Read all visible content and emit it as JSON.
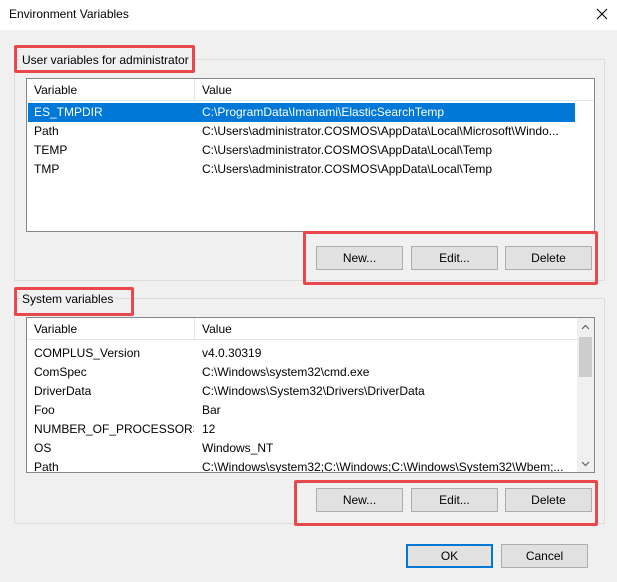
{
  "window": {
    "title": "Environment Variables"
  },
  "user_section": {
    "label": "User variables for administrator",
    "columns": [
      "Variable",
      "Value"
    ],
    "rows": [
      {
        "variable": "ES_TMPDIR",
        "value": "C:\\ProgramData\\Imanami\\ElasticSearchTemp",
        "selected": true
      },
      {
        "variable": "Path",
        "value": "C:\\Users\\administrator.COSMOS\\AppData\\Local\\Microsoft\\Windo..."
      },
      {
        "variable": "TEMP",
        "value": "C:\\Users\\administrator.COSMOS\\AppData\\Local\\Temp"
      },
      {
        "variable": "TMP",
        "value": "C:\\Users\\administrator.COSMOS\\AppData\\Local\\Temp"
      }
    ],
    "buttons": {
      "new": "New...",
      "edit": "Edit...",
      "delete": "Delete"
    }
  },
  "system_section": {
    "label": "System variables",
    "columns": [
      "Variable",
      "Value"
    ],
    "rows": [
      {
        "variable": "COMPLUS_Version",
        "value": "v4.0.30319"
      },
      {
        "variable": "ComSpec",
        "value": "C:\\Windows\\system32\\cmd.exe"
      },
      {
        "variable": "DriverData",
        "value": "C:\\Windows\\System32\\Drivers\\DriverData"
      },
      {
        "variable": "Foo",
        "value": "Bar"
      },
      {
        "variable": "NUMBER_OF_PROCESSORS",
        "value": "12"
      },
      {
        "variable": "OS",
        "value": "Windows_NT"
      },
      {
        "variable": "Path",
        "value": "C:\\Windows\\system32;C:\\Windows;C:\\Windows\\System32\\Wbem;..."
      }
    ],
    "buttons": {
      "new": "New...",
      "edit": "Edit...",
      "delete": "Delete"
    }
  },
  "footer": {
    "ok": "OK",
    "cancel": "Cancel"
  },
  "colors": {
    "highlight": "#e8474b",
    "selection": "#0078d7",
    "default_button_border": "#0078d7"
  },
  "icons": {
    "close": "close-icon",
    "scroll_up": "chevron-up-icon",
    "scroll_down": "chevron-down-icon"
  }
}
